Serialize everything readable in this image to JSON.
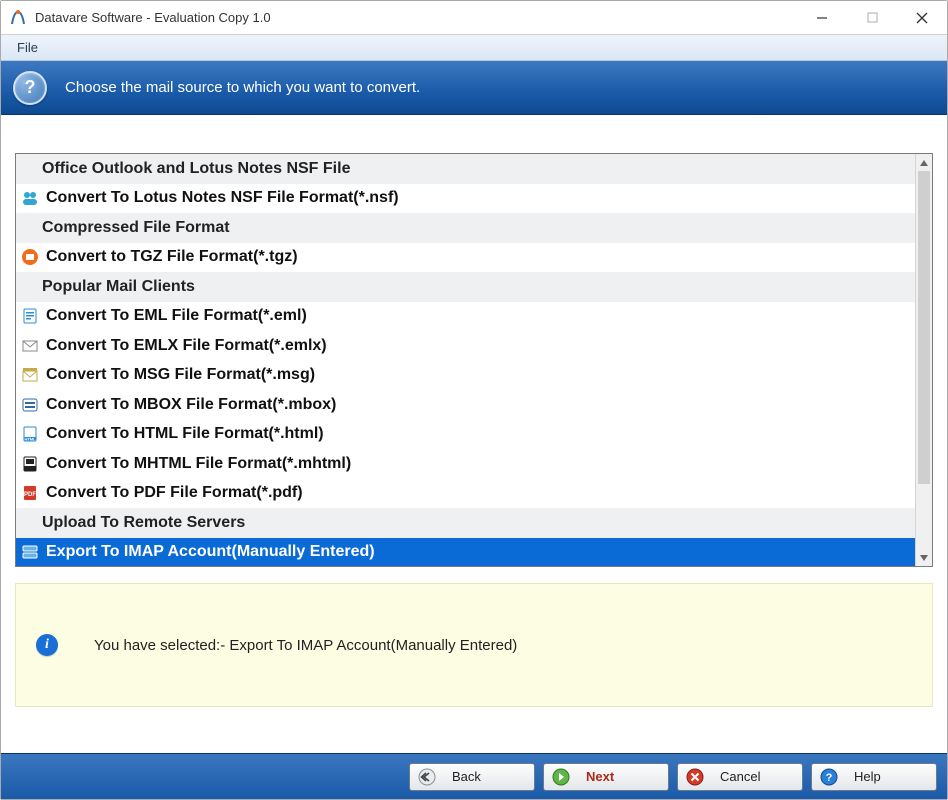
{
  "window": {
    "title": "Datavare Software - Evaluation Copy 1.0"
  },
  "menubar": {
    "file": "File"
  },
  "banner": {
    "text": "Choose the mail source to which you want to convert."
  },
  "list": {
    "selected_index": 13,
    "rows": [
      {
        "kind": "header",
        "label": "Office Outlook and Lotus Notes NSF File"
      },
      {
        "kind": "item",
        "label": "Convert To Lotus Notes NSF File Format(*.nsf)",
        "icon": "people-icon",
        "icon_color": "#2fa6d4"
      },
      {
        "kind": "header",
        "label": "Compressed File Format"
      },
      {
        "kind": "item",
        "label": "Convert to TGZ File Format(*.tgz)",
        "icon": "archive-icon",
        "icon_color": "#f26a1b"
      },
      {
        "kind": "header",
        "label": "Popular Mail Clients"
      },
      {
        "kind": "item",
        "label": "Convert To EML File Format(*.eml)",
        "icon": "file-icon",
        "icon_color": "#2f8bd6"
      },
      {
        "kind": "item",
        "label": "Convert To EMLX File Format(*.emlx)",
        "icon": "envelope-icon",
        "icon_color": "#888"
      },
      {
        "kind": "item",
        "label": "Convert To MSG File Format(*.msg)",
        "icon": "msg-icon",
        "icon_color": "#c7a84a"
      },
      {
        "kind": "item",
        "label": "Convert To MBOX File Format(*.mbox)",
        "icon": "mbox-icon",
        "icon_color": "#2f6aa8"
      },
      {
        "kind": "item",
        "label": "Convert To HTML File Format(*.html)",
        "icon": "html-icon",
        "icon_color": "#2f8bd6"
      },
      {
        "kind": "item",
        "label": "Convert To MHTML File Format(*.mhtml)",
        "icon": "mhtml-icon",
        "icon_color": "#222"
      },
      {
        "kind": "item",
        "label": "Convert To PDF File Format(*.pdf)",
        "icon": "pdf-icon",
        "icon_color": "#d43a2a"
      },
      {
        "kind": "header",
        "label": "Upload To Remote Servers"
      },
      {
        "kind": "item",
        "label": "Export To IMAP Account(Manually Entered)",
        "icon": "server-icon",
        "icon_color": "#ffffff"
      }
    ]
  },
  "info": {
    "prefix": "You have selected:- ",
    "selection": "Export To IMAP Account(Manually Entered)"
  },
  "footer": {
    "back": "Back",
    "next": "Next",
    "cancel": "Cancel",
    "help": "Help"
  }
}
